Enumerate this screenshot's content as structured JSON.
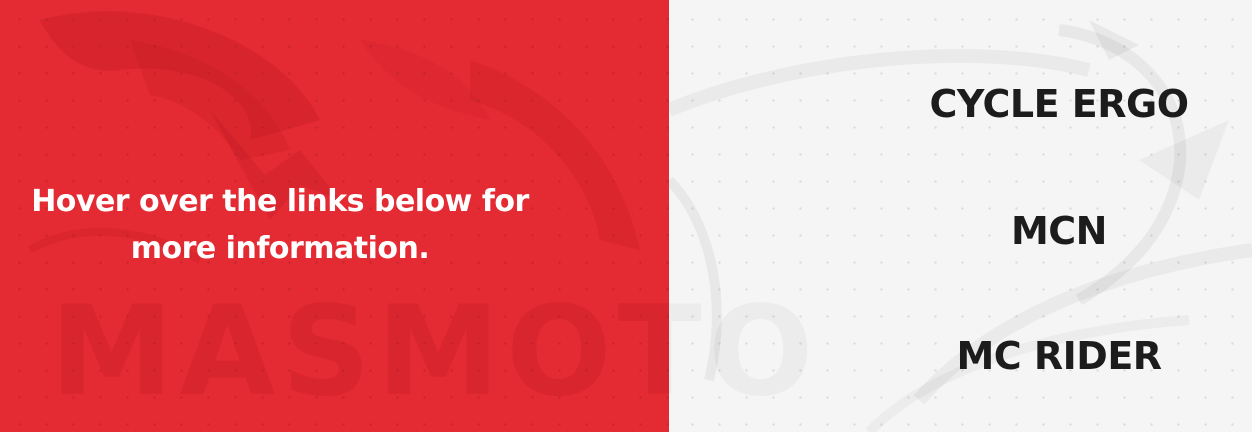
{
  "intro": {
    "text": "Hover over the links below for more information."
  },
  "brand": {
    "watermark_text": "MASMOTO"
  },
  "links": [
    {
      "label": "CYCLE ERGO"
    },
    {
      "label": "MCN"
    },
    {
      "label": "MC RIDER"
    }
  ],
  "colors": {
    "accent_red": "#e42a32",
    "panel_light": "#f5f5f5",
    "link_text": "#1c1c1c",
    "intro_text": "#ffffff"
  }
}
